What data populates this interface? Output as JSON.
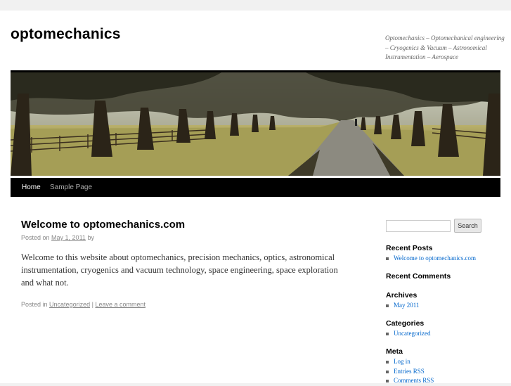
{
  "site": {
    "title": "optomechanics",
    "description": "Optomechanics – Optomechanical engineering – Cryogenics & Vacuum – Astronomical Instrumentation – Aerospace"
  },
  "nav": {
    "items": [
      {
        "label": "Home",
        "current": true
      },
      {
        "label": "Sample Page",
        "current": false
      }
    ]
  },
  "post": {
    "title": "Welcome to optomechanics.com",
    "meta_prefix": "Posted on",
    "date": "May 1, 2011",
    "meta_by": "by",
    "body": "Welcome to  this website about optomechanics, precision mechanics, optics, astronomical instrumentation, cryogenics and vacuum technology, space engineering, space exploration and what not.",
    "posted_in_label": "Posted in",
    "category": "Uncategorized",
    "separator": "|",
    "comment_link": "Leave a comment"
  },
  "sidebar": {
    "search": {
      "placeholder": "",
      "button_label": "Search"
    },
    "recent_posts": {
      "title": "Recent Posts",
      "items": [
        "Welcome to optomechanics.com"
      ]
    },
    "recent_comments": {
      "title": "Recent Comments"
    },
    "archives": {
      "title": "Archives",
      "items": [
        "May 2011"
      ]
    },
    "categories": {
      "title": "Categories",
      "items": [
        "Uncategorized"
      ]
    },
    "meta": {
      "title": "Meta",
      "items": [
        "Log in",
        "Entries RSS",
        "Comments RSS"
      ]
    }
  },
  "colors": {
    "link": "#0066cc",
    "nav_bg": "#000000",
    "page_bg": "#f1f1f1"
  }
}
